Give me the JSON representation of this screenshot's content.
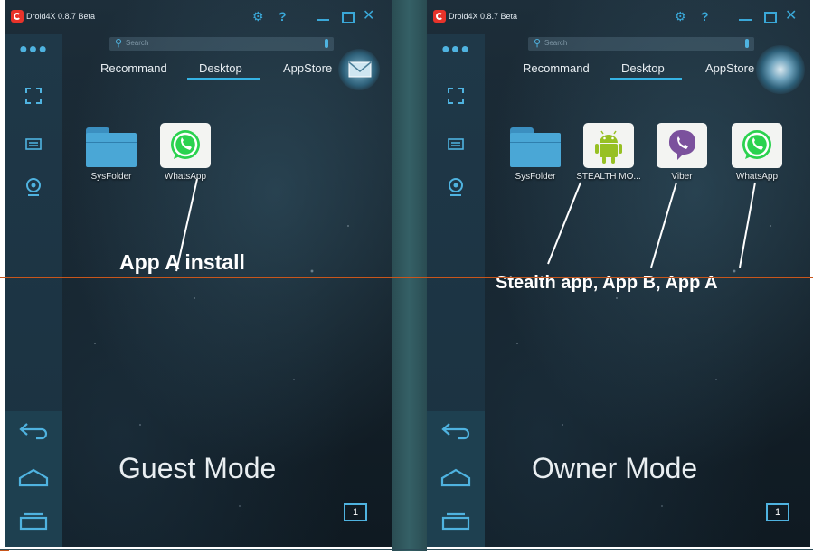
{
  "left": {
    "app_title": "Droid4X 0.8.7 Beta",
    "search_placeholder": "Search",
    "tabs": [
      "Recommand",
      "Desktop",
      "AppStore"
    ],
    "apps": [
      "SysFolder",
      "WhatsApp"
    ],
    "annotation": "App A install",
    "mode_label": "Guest Mode",
    "page_number": "1"
  },
  "right": {
    "app_title": "Droid4X 0.8.7 Beta",
    "search_placeholder": "Search",
    "tabs": [
      "Recommand",
      "Desktop",
      "AppStore"
    ],
    "apps": [
      "SysFolder",
      "STEALTH MO...",
      "Viber",
      "WhatsApp"
    ],
    "annotation": "Stealth app, App B, App A",
    "mode_label": "Owner Mode",
    "page_number": "1"
  },
  "titlebar_icons": [
    "gear-icon",
    "help-icon",
    "minimize-icon",
    "maximize-icon",
    "close-icon"
  ],
  "sidebar_icons": [
    "more-icon",
    "fullscreen-icon",
    "keyboard-icon",
    "camera-icon",
    "back-icon",
    "home-icon",
    "recents-icon"
  ],
  "colors": {
    "accent": "#36b3e4",
    "whatsapp": "#2bd24f",
    "viber": "#7b519d",
    "android": "#97c024",
    "annotation_line": "#c8561c"
  }
}
